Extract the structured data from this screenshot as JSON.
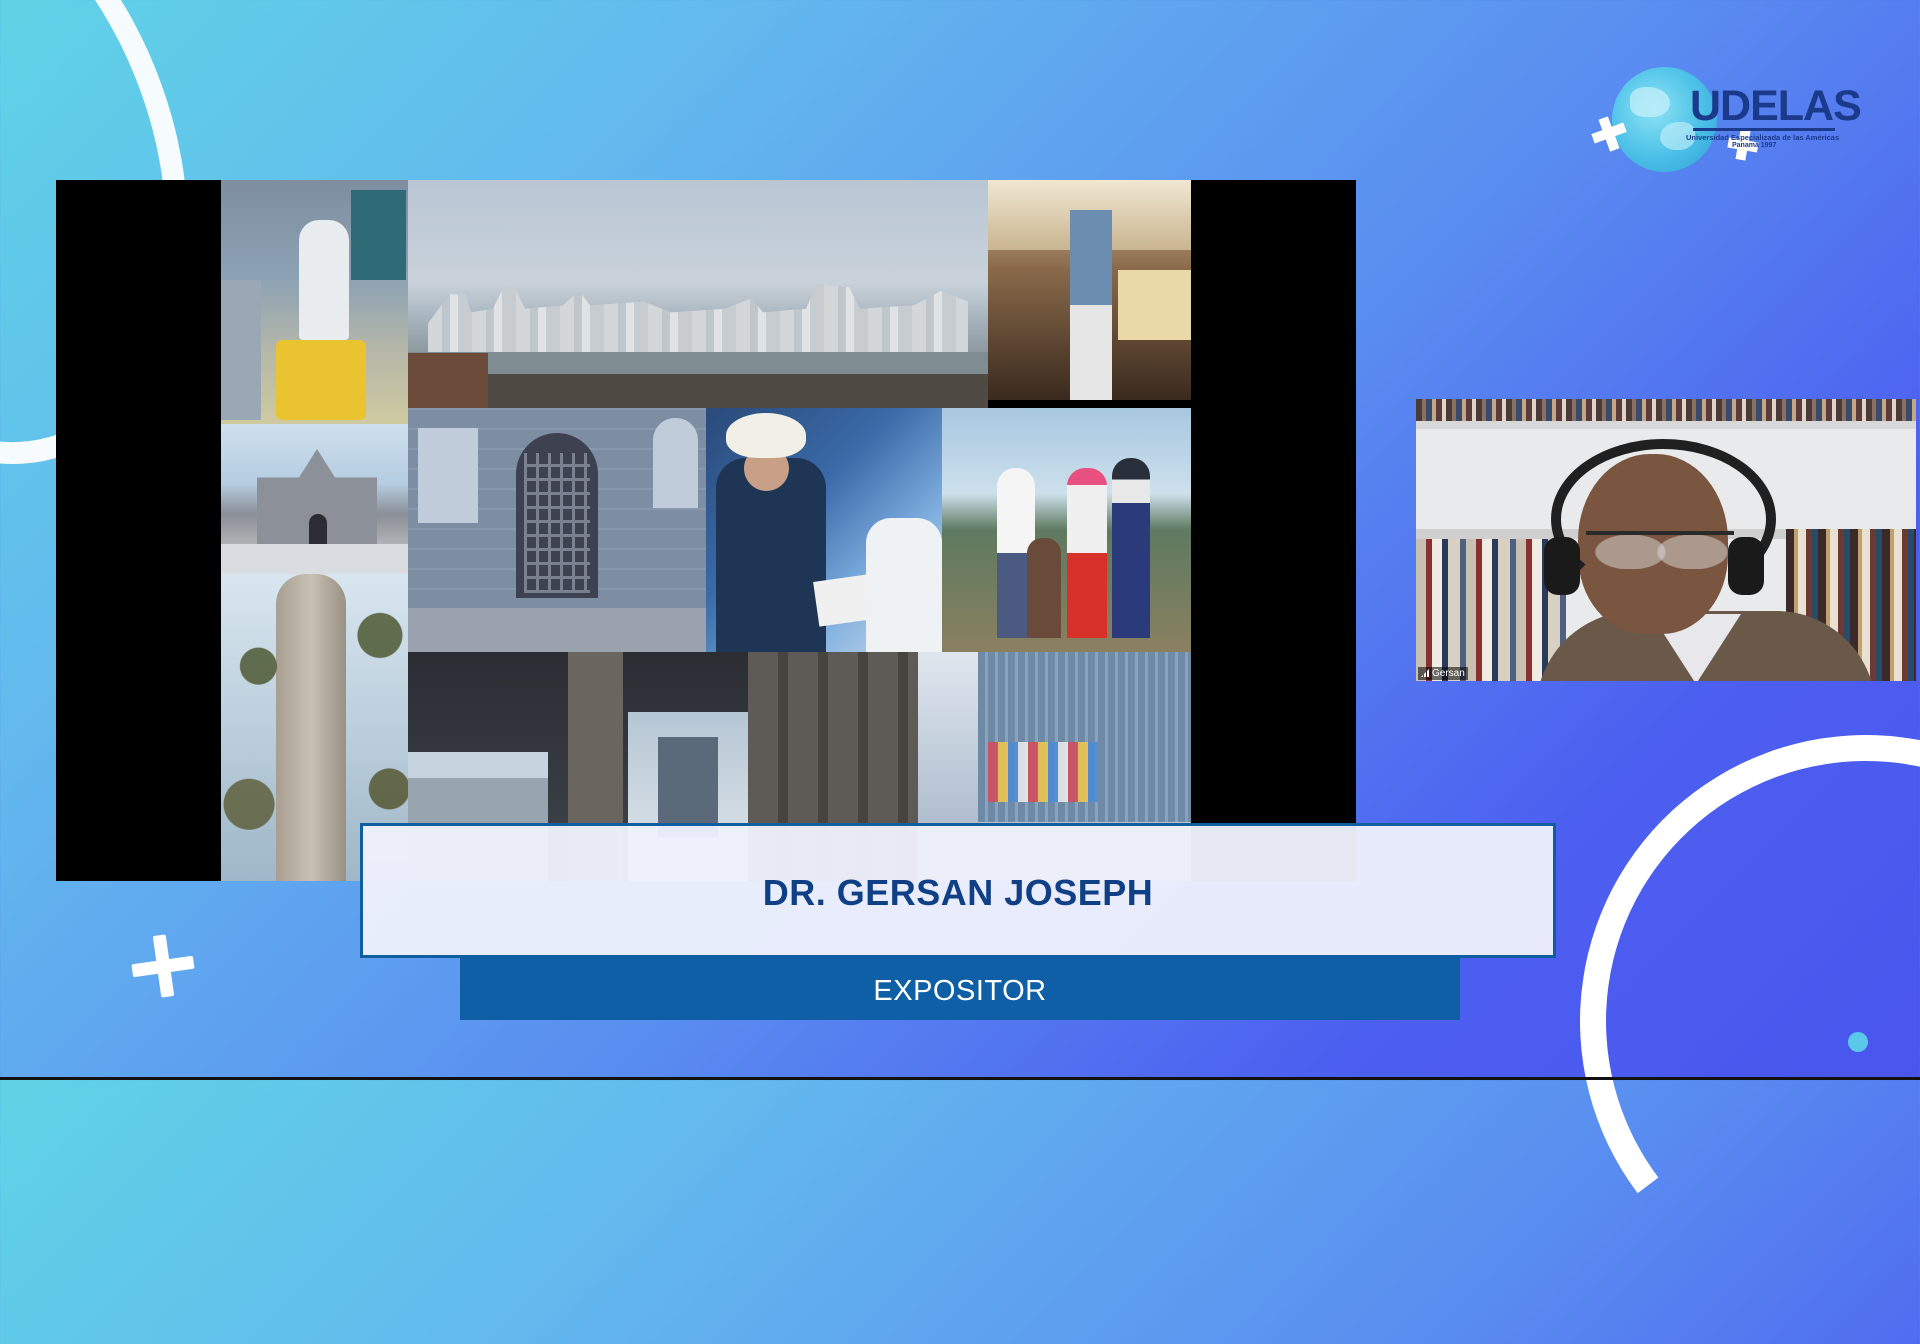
{
  "logo": {
    "name": "UDELAS",
    "subtitle_line1": "Universidad Especializada de las Américas",
    "subtitle_line2": "Panamá 1997"
  },
  "presenter": {
    "name": "DR. GERSAN JOSEPH",
    "role": "EXPOSITOR"
  },
  "participant": {
    "name": "Gersan"
  },
  "colors": {
    "accent": "#0e5fa6",
    "name_text": "#0f3f85",
    "lower_third_bg": "#eef0fc"
  }
}
